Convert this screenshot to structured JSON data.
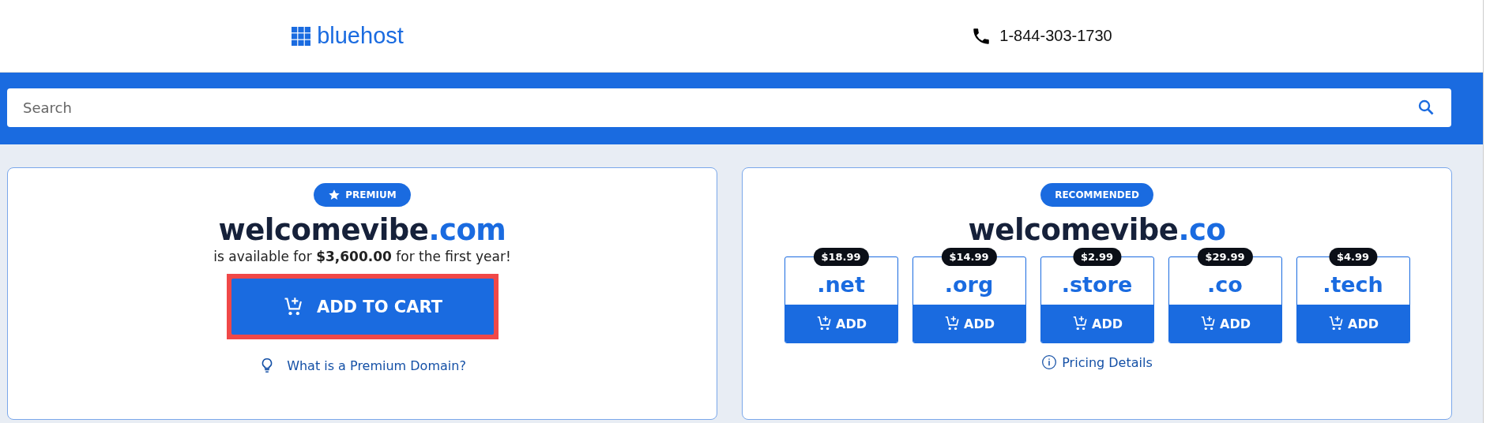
{
  "header": {
    "logo": "bluehost",
    "phone": "1-844-303-1730"
  },
  "search": {
    "placeholder": "Search"
  },
  "premium": {
    "badge": "PREMIUM",
    "name": "welcomevibe",
    "tld": ".com",
    "availability": "is available for **$3,600.00** for the first year!",
    "button": "ADD TO CART",
    "highlighted": true,
    "link": "What is a Premium Domain?"
  },
  "recommended": {
    "badge": "RECOMMENDED",
    "name": "welcomevibe",
    "tld": ".co",
    "options": [
      {
        "price": "$18.99",
        "tld": ".net",
        "button": "ADD"
      },
      {
        "price": "$14.99",
        "tld": ".org",
        "button": "ADD"
      },
      {
        "price": "$2.99",
        "tld": ".store",
        "button": "ADD"
      },
      {
        "price": "$29.99",
        "tld": ".co",
        "button": "ADD"
      },
      {
        "price": "$4.99",
        "tld": ".tech",
        "button": "ADD"
      }
    ],
    "link": "Pricing Details"
  }
}
